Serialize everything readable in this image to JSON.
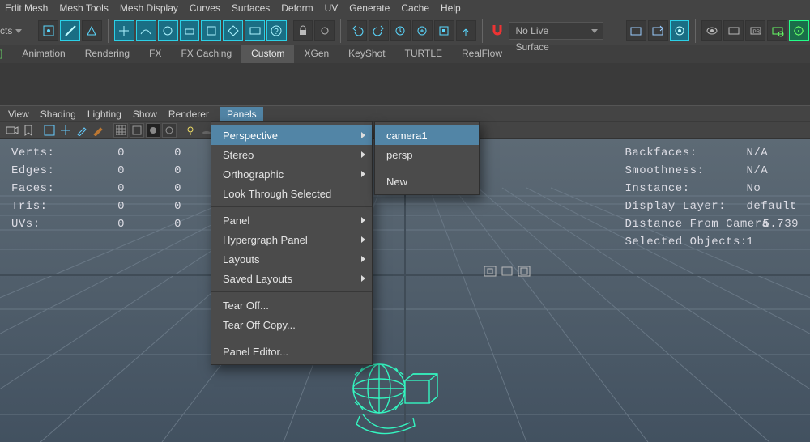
{
  "main_menu": [
    "Edit Mesh",
    "Mesh Tools",
    "Mesh Display",
    "Curves",
    "Surfaces",
    "Deform",
    "UV",
    "Generate",
    "Cache",
    "Help"
  ],
  "shelf": {
    "left_label": "cts",
    "live_surface": "No Live Surface"
  },
  "shelf_tabs": {
    "first_cut": "]",
    "items": [
      "Animation",
      "Rendering",
      "FX",
      "FX Caching",
      "Custom",
      "XGen",
      "KeyShot",
      "TURTLE",
      "RealFlow"
    ],
    "active": "Custom"
  },
  "panel_menu": [
    "View",
    "Shading",
    "Lighting",
    "Show",
    "Renderer",
    "Panels"
  ],
  "panel_menu_open": "Panels",
  "dropdown1": {
    "groups": [
      [
        "Perspective",
        "Stereo",
        "Orthographic",
        "Look Through Selected"
      ],
      [
        "Panel",
        "Hypergraph Panel",
        "Layouts",
        "Saved Layouts"
      ],
      [
        "Tear Off...",
        "Tear Off Copy..."
      ],
      [
        "Panel Editor..."
      ]
    ],
    "sub_items": [
      "Perspective",
      "Stereo",
      "Orthographic",
      "Panel",
      "Hypergraph Panel",
      "Layouts",
      "Saved Layouts"
    ],
    "check_items": [
      "Look Through Selected"
    ],
    "highlight": "Perspective"
  },
  "dropdown2": {
    "items": [
      "camera1",
      "persp",
      "New"
    ],
    "highlight": "camera1"
  },
  "hud_left": {
    "rows": [
      {
        "label": "Verts:",
        "v1": "0",
        "v2": "0"
      },
      {
        "label": "Edges:",
        "v1": "0",
        "v2": "0"
      },
      {
        "label": "Faces:",
        "v1": "0",
        "v2": "0"
      },
      {
        "label": "Tris:",
        "v1": "0",
        "v2": "0"
      },
      {
        "label": "UVs:",
        "v1": "0",
        "v2": "0"
      }
    ]
  },
  "hud_right": {
    "rows": [
      {
        "label": "Backfaces:",
        "value": "N/A"
      },
      {
        "label": "Smoothness:",
        "value": "N/A"
      },
      {
        "label": "Instance:",
        "value": "No"
      },
      {
        "label": "Display Layer:",
        "value": "default"
      },
      {
        "label": "Distance From Camera",
        "value": "5.739"
      },
      {
        "label": "Selected Objects:",
        "value": "1"
      }
    ]
  }
}
